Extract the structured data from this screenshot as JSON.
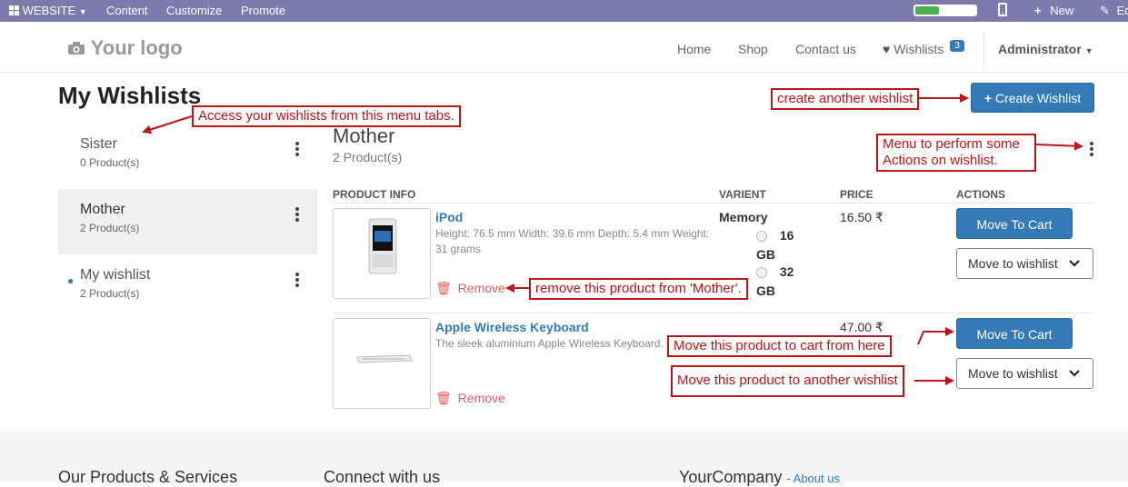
{
  "topbar": {
    "website_label": "WEBSITE",
    "menu": [
      "Content",
      "Customize",
      "Promote"
    ],
    "new_label": "New",
    "edit_label": "Ed",
    "progress": 0.4
  },
  "header": {
    "logo": "Your logo",
    "nav": [
      "Home",
      "Shop",
      "Contact us"
    ],
    "wishlists_label": "Wishlists",
    "wishlists_count": "3",
    "user": "Administrator"
  },
  "page_title": "My Wishlists",
  "create_button": "Create Wishlist",
  "sidebar": {
    "items": [
      {
        "name": "Sister",
        "count": "0 Product(s)"
      },
      {
        "name": "Mother",
        "count": "2 Product(s)"
      },
      {
        "name": "My wishlist",
        "count": "2 Product(s)"
      }
    ]
  },
  "main": {
    "title": "Mother",
    "count": "2 Product(s)",
    "columns": [
      "PRODUCT INFO",
      "VARIENT",
      "PRICE",
      "ACTIONS"
    ],
    "products": [
      {
        "name": "iPod",
        "desc": "Height: 76.5 mm Width: 39.6 mm Depth: 5.4 mm Weight: 31 grams",
        "remove": "Remove",
        "variant_label": "Memory",
        "variant_options": [
          {
            "num": "16",
            "unit": "GB"
          },
          {
            "num": "32",
            "unit": "GB"
          }
        ],
        "price": "16.50 ₹",
        "cart_btn": "Move To Cart",
        "move_btn": "Move to wishlist"
      },
      {
        "name": "Apple Wireless Keyboard",
        "desc": "The sleek aluminium Apple Wireless Keyboard.",
        "remove": "Remove",
        "price": "47.00 ₹",
        "cart_btn": "Move To Cart",
        "move_btn": "Move to wishlist"
      }
    ]
  },
  "annotations": {
    "menu_tabs": "Access your wishlists from this menu tabs.",
    "create": "create another wishlist",
    "actions_menu_1": "Menu to perform some",
    "actions_menu_2": "Actions on wishlist.",
    "remove": "remove this product from 'Mother'.",
    "cart": "Move this product to cart from here",
    "move": "Move this product to another wishlist"
  },
  "footer": {
    "col1": "Our Products & Services",
    "col2": "Connect with us",
    "col3": "YourCompany",
    "col3_link": "About us"
  },
  "colors": {
    "topbar": "#7c7bad",
    "primary": "#337ab7",
    "annotation": "#c0141b",
    "remove": "#e35d5d"
  }
}
